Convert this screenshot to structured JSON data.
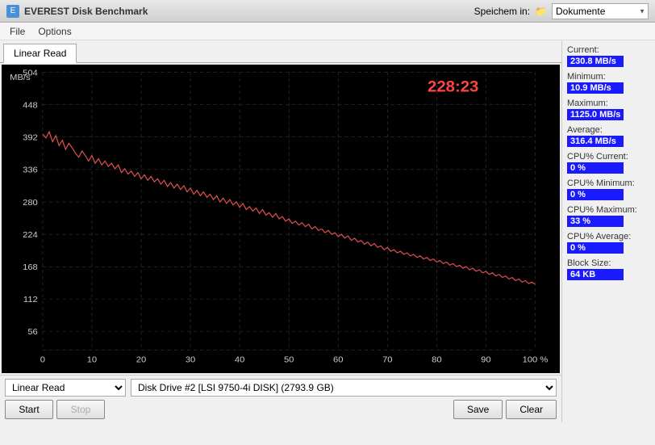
{
  "titleBar": {
    "icon": "E",
    "title": "EVEREST Disk Benchmark"
  },
  "saveasBar": {
    "label": "Speichem in:",
    "folder": "Dokumente"
  },
  "menuBar": {
    "items": [
      "File",
      "Options"
    ]
  },
  "tabs": {
    "active": "Linear Read"
  },
  "chart": {
    "timer": "228:23",
    "yLabel": "MB/s",
    "yTicks": [
      "504",
      "448",
      "392",
      "336",
      "280",
      "224",
      "168",
      "112",
      "56"
    ],
    "xTicks": [
      "0",
      "10",
      "20",
      "30",
      "40",
      "50",
      "60",
      "70",
      "80",
      "90",
      "100 %"
    ]
  },
  "stats": {
    "currentLabel": "Current:",
    "currentValue": "230.8 MB/s",
    "minimumLabel": "Minimum:",
    "minimumValue": "10.9 MB/s",
    "maximumLabel": "Maximum:",
    "maximumValue": "1125.0 MB/s",
    "averageLabel": "Average:",
    "averageValue": "316.4 MB/s",
    "cpuCurrentLabel": "CPU% Current:",
    "cpuCurrentValue": "0 %",
    "cpuMinimumLabel": "CPU% Minimum:",
    "cpuMinimumValue": "0 %",
    "cpuMaximumLabel": "CPU% Maximum:",
    "cpuMaximumValue": "33 %",
    "cpuAverageLabel": "CPU% Average:",
    "cpuAverageValue": "0 %",
    "blockSizeLabel": "Block Size:",
    "blockSizeValue": "64 KB"
  },
  "controls": {
    "testLabel": "Linear Read",
    "diskLabel": "Disk Drive #2  [LSI 9750-4i   DISK]  (2793.9 GB)",
    "startBtn": "Start",
    "stopBtn": "Stop",
    "saveBtn": "Save",
    "clearBtn": "Clear"
  }
}
